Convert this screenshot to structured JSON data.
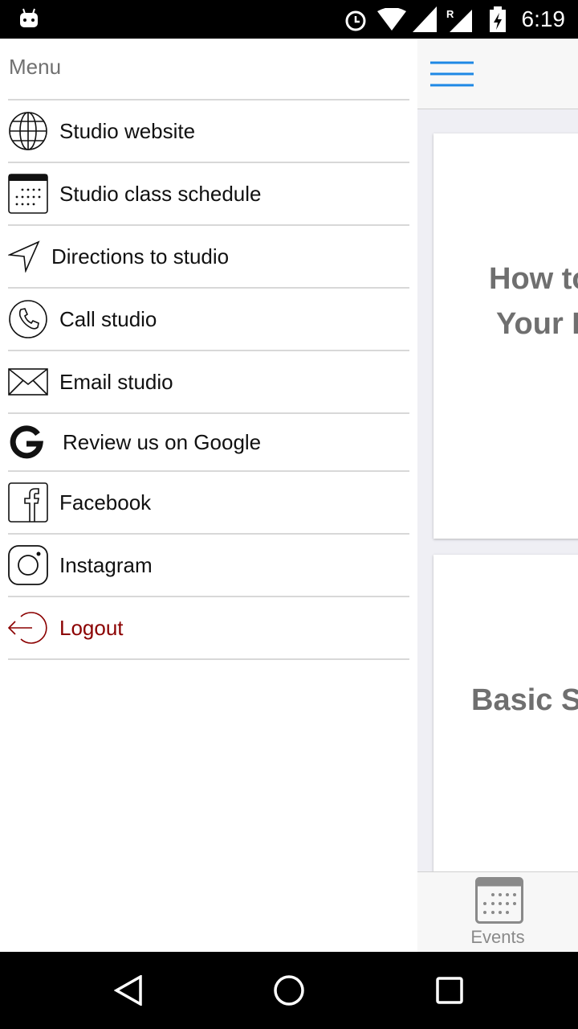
{
  "status_bar": {
    "time": "6:19"
  },
  "drawer": {
    "title": "Menu",
    "items": [
      {
        "label": "Studio website",
        "icon": "globe-icon"
      },
      {
        "label": "Studio class schedule",
        "icon": "calendar-icon"
      },
      {
        "label": "Directions to studio",
        "icon": "navigation-arrow-icon"
      },
      {
        "label": "Call studio",
        "icon": "phone-icon"
      },
      {
        "label": "Email studio",
        "icon": "envelope-icon"
      },
      {
        "label": "Review us on Google",
        "icon": "google-icon"
      },
      {
        "label": "Facebook",
        "icon": "facebook-icon"
      },
      {
        "label": "Instagram",
        "icon": "instagram-icon"
      },
      {
        "label": "Logout",
        "icon": "logout-icon",
        "color": "#8b0000"
      }
    ]
  },
  "main": {
    "cards": [
      {
        "line1": "How to",
        "line2": "Your B"
      },
      {
        "line1": "Basic S"
      }
    ],
    "tabbar": {
      "label": "Events"
    },
    "accent": "#1e88e5"
  }
}
